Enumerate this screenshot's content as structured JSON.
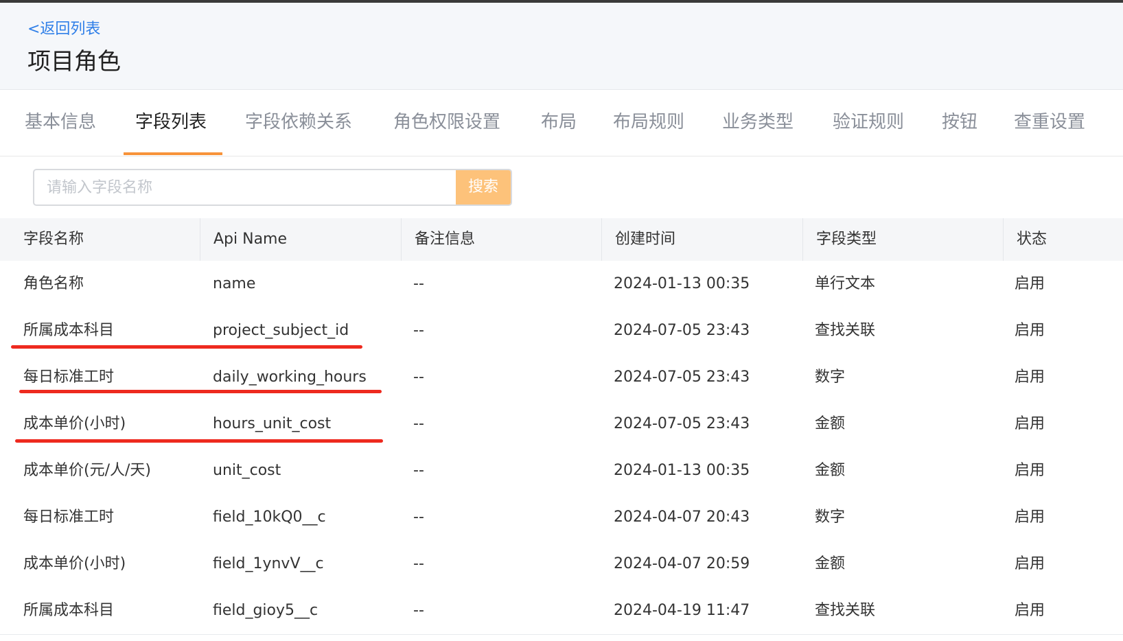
{
  "header": {
    "back_label": "<返回列表",
    "title": "项目角色"
  },
  "tabs": [
    {
      "label": "基本信息",
      "active": false
    },
    {
      "label": "字段列表",
      "active": true
    },
    {
      "label": "字段依赖关系",
      "active": false
    },
    {
      "label": "角色权限设置",
      "active": false
    },
    {
      "label": "布局",
      "active": false
    },
    {
      "label": "布局规则",
      "active": false
    },
    {
      "label": "业务类型",
      "active": false
    },
    {
      "label": "验证规则",
      "active": false
    },
    {
      "label": "按钮",
      "active": false
    },
    {
      "label": "查重设置",
      "active": false
    }
  ],
  "search": {
    "placeholder": "请输入字段名称",
    "button_label": "搜索"
  },
  "table": {
    "columns": [
      "字段名称",
      "Api Name",
      "备注信息",
      "创建时间",
      "字段类型",
      "状态"
    ],
    "rows": [
      {
        "name": "角色名称",
        "api": "name",
        "note": "--",
        "created": "2024-01-13 00:35",
        "type": "单行文本",
        "status": "启用"
      },
      {
        "name": "所属成本科目",
        "api": "project_subject_id",
        "note": "--",
        "created": "2024-07-05 23:43",
        "type": "查找关联",
        "status": "启用"
      },
      {
        "name": "每日标准工时",
        "api": "daily_working_hours",
        "note": "--",
        "created": "2024-07-05 23:43",
        "type": "数字",
        "status": "启用"
      },
      {
        "name": "成本单价(小时)",
        "api": "hours_unit_cost",
        "note": "--",
        "created": "2024-07-05 23:43",
        "type": "金额",
        "status": "启用"
      },
      {
        "name": "成本单价(元/人/天)",
        "api": "unit_cost",
        "note": "--",
        "created": "2024-01-13 00:35",
        "type": "金额",
        "status": "启用"
      },
      {
        "name": "每日标准工时",
        "api": "field_10kQ0__c",
        "note": "--",
        "created": "2024-04-07 20:43",
        "type": "数字",
        "status": "启用"
      },
      {
        "name": "成本单价(小时)",
        "api": "field_1ynvV__c",
        "note": "--",
        "created": "2024-04-07 20:59",
        "type": "金额",
        "status": "启用"
      },
      {
        "name": "所属成本科目",
        "api": "field_gioy5__c",
        "note": "--",
        "created": "2024-04-19 11:47",
        "type": "查找关联",
        "status": "启用"
      }
    ]
  },
  "colors": {
    "link": "#2f7fe8",
    "accent": "#f7933a",
    "search_button": "#fdc27a",
    "annotation": "#ee2a1f"
  }
}
